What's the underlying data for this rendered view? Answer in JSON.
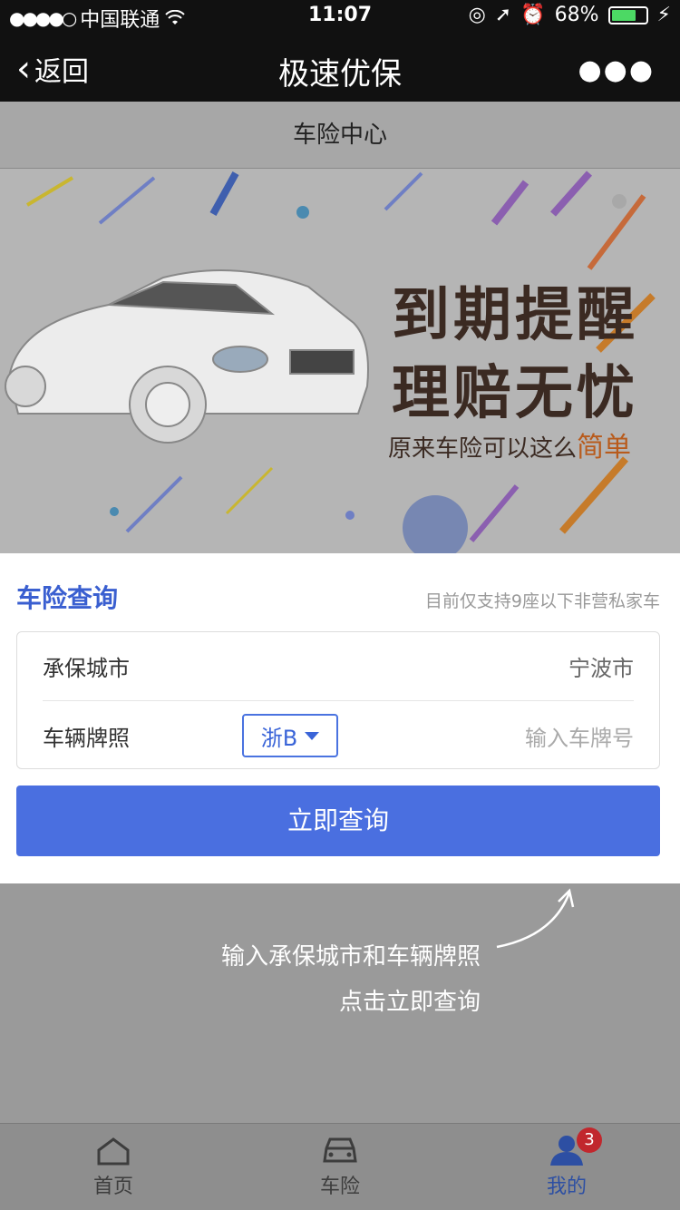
{
  "status_bar": {
    "carrier": "中国联通",
    "time": "11:07",
    "battery": "68%",
    "battery_level": 0.68
  },
  "nav": {
    "back_label": "返回",
    "title": "极速优保"
  },
  "page": {
    "sub_header": "车险中心",
    "banner": {
      "line1": "到期提醒",
      "line2": "理赔无忧",
      "tagline": "原来车险可以这么",
      "tagline_highlight": "简单"
    }
  },
  "card": {
    "title": "车险查询",
    "note": "目前仅支持9座以下非营私家车",
    "city_label": "承保城市",
    "city_value": "宁波市",
    "plate_label": "车辆牌照",
    "plate_prefix": "浙B",
    "plate_placeholder": "输入车牌号",
    "query_button": "立即查询"
  },
  "guide": {
    "line1": "输入承保城市和车辆牌照",
    "line2": "点击立即查询"
  },
  "tab_bar": {
    "tabs": [
      {
        "label": "首页",
        "icon": "home-icon"
      },
      {
        "label": "车险",
        "icon": "car-icon"
      },
      {
        "label": "我的",
        "icon": "user-icon",
        "badge": "3"
      }
    ]
  },
  "colors": {
    "accent": "#4a6fe0",
    "badge": "#c1272d",
    "title_blue": "#3a5fd0"
  }
}
